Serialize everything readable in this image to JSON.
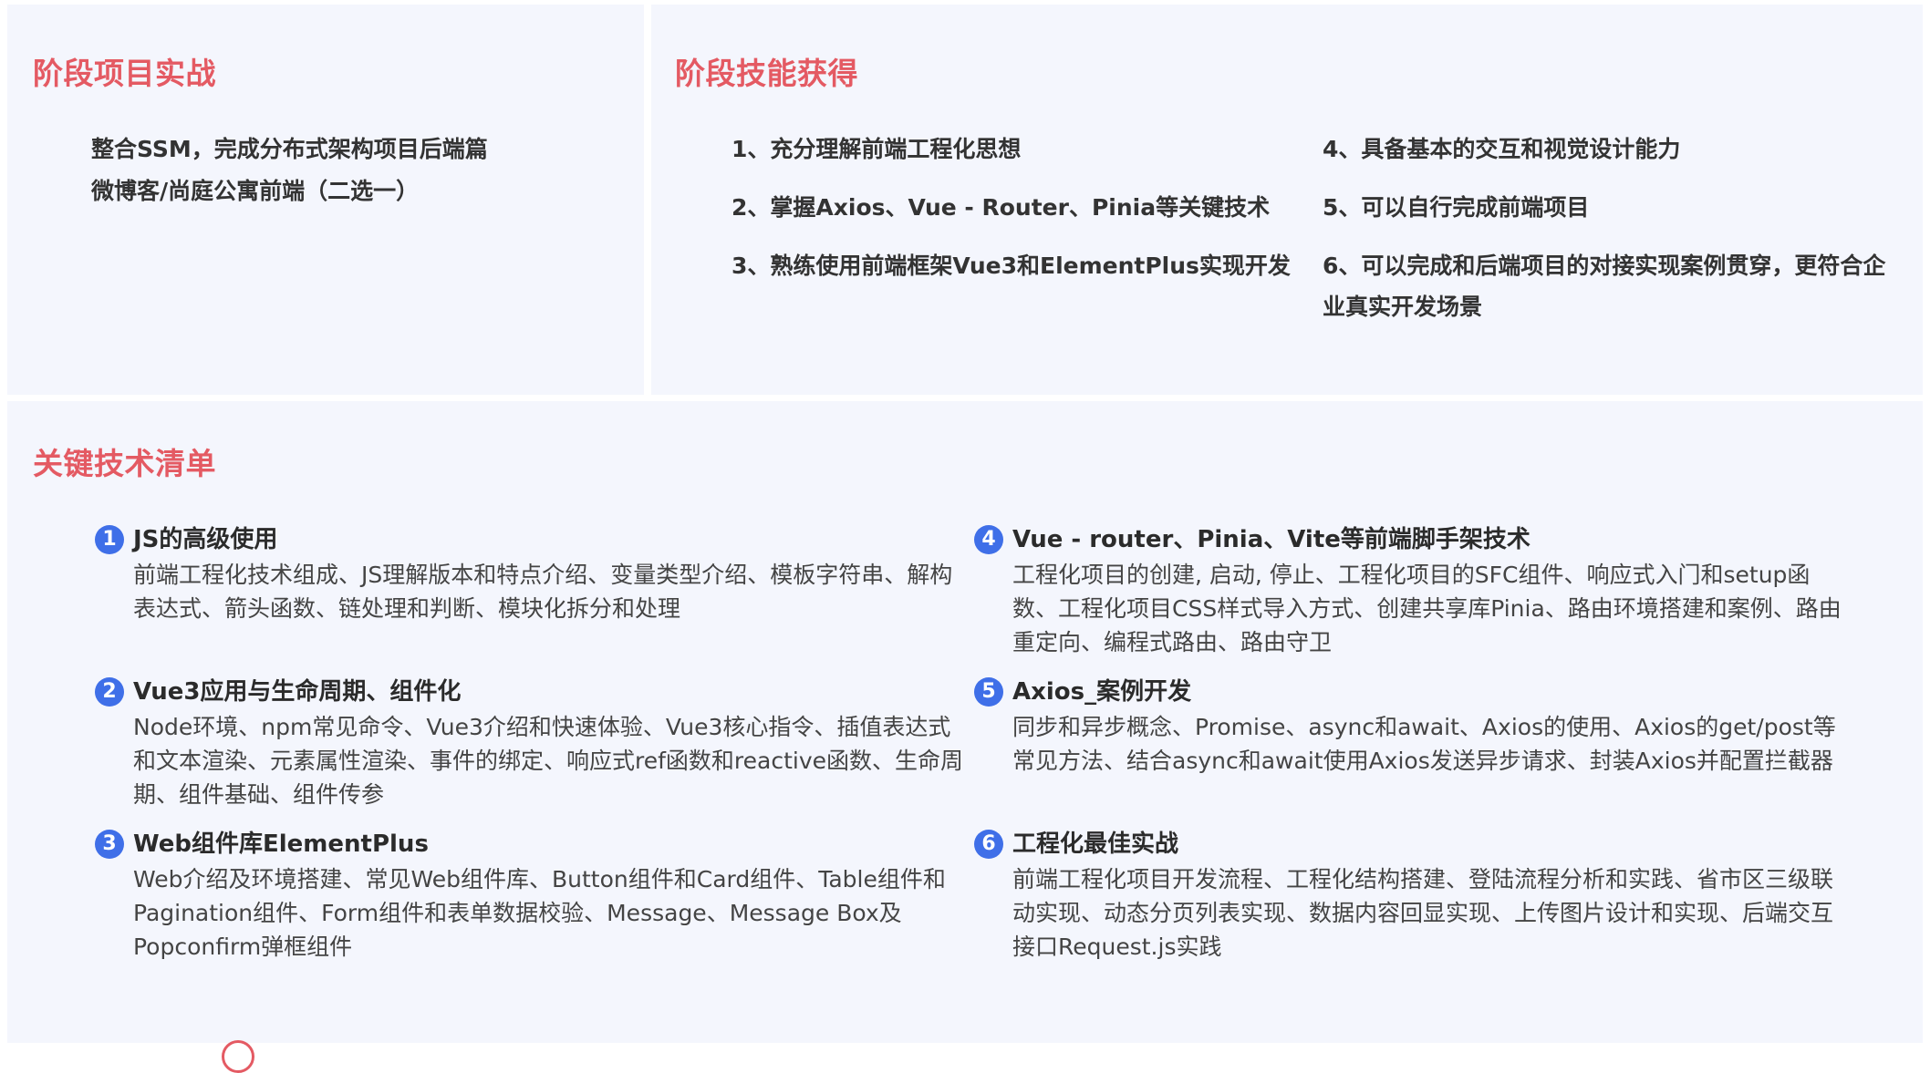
{
  "projects": {
    "title": "阶段项目实战",
    "items": [
      "整合SSM，完成分布式架构项目后端篇",
      "微博客/尚庭公寓前端（二选一）"
    ]
  },
  "skills": {
    "title": "阶段技能获得",
    "items": [
      "1、充分理解前端工程化思想",
      "2、掌握Axios、Vue - Router、Pinia等关键技术",
      "3、熟练使用前端框架Vue3和ElementPlus实现开发",
      "4、具备基本的交互和视觉设计能力",
      "5、可以自行完成前端项目",
      "6、可以完成和后端项目的对接实现案例贯穿，更符合企业真实开发场景"
    ]
  },
  "tech": {
    "title": "关键技术清单",
    "items": [
      {
        "num": "1",
        "title": "JS的高级使用",
        "desc": "前端工程化技术组成、JS理解版本和特点介绍、变量类型介绍、模板字符串、解构表达式、箭头函数、链处理和判断、模块化拆分和处理"
      },
      {
        "num": "2",
        "title": "Vue3应用与生命周期、组件化",
        "desc": "Node环境、npm常见命令、Vue3介绍和快速体验、Vue3核心指令、插值表达式和文本渲染、元素属性渲染、事件的绑定、响应式ref函数和reactive函数、生命周期、组件基础、组件传参"
      },
      {
        "num": "3",
        "title": "Web组件库ElementPlus",
        "desc": "Web介绍及环境搭建、常见Web组件库、Button组件和Card组件、Table组件和Pagination组件、Form组件和表单数据校验、Message、Message Box及Popconfirm弹框组件"
      },
      {
        "num": "4",
        "title": "Vue - router、Pinia、Vite等前端脚手架技术",
        "desc": "工程化项目的创建, 启动, 停止、工程化项目的SFC组件、响应式入门和setup函数、工程化项目CSS样式导入方式、创建共享库Pinia、路由环境搭建和案例、路由重定向、编程式路由、路由守卫"
      },
      {
        "num": "5",
        "title": "Axios_案例开发",
        "desc": "同步和异步概念、Promise、async和await、Axios的使用、Axios的get/post等常见方法、结合async和await使用Axios发送异步请求、封装Axios并配置拦截器"
      },
      {
        "num": "6",
        "title": "工程化最佳实战",
        "desc": "前端工程化项目开发流程、工程化结构搭建、登陆流程分析和实践、省市区三级联动实现、动态分页列表实现、数据内容回显实现、上传图片设计和实现、后端交互接口Request.js实践"
      }
    ]
  },
  "colors": {
    "title_accent": "#e45a63",
    "badge": "#3f6fe8",
    "panel_bg": "#f4f6fd"
  }
}
